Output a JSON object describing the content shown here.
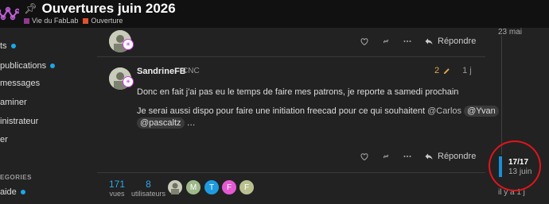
{
  "header": {
    "title": "Ouvertures juin 2026",
    "pin_icon": "pin-icon",
    "categories": [
      {
        "label": "Vie du FabLab",
        "color": "#8e3b8e"
      },
      {
        "label": "Ouverture",
        "color": "#e2522e"
      }
    ]
  },
  "sidebar": {
    "items": [
      {
        "label": "ts",
        "unread": true
      },
      {
        "label": "publications",
        "unread": true
      },
      {
        "label": "messages",
        "unread": false
      },
      {
        "label": "aminer",
        "unread": false
      },
      {
        "label": "inistrateur",
        "unread": false
      },
      {
        "label": "er",
        "unread": false
      }
    ],
    "section": "EGORIES",
    "category_item": {
      "label": "aide",
      "unread": true
    }
  },
  "post_top": {
    "reply_label": "Répondre"
  },
  "post": {
    "username": "SandrineFB",
    "user_title": "CNC",
    "edit_count": "2",
    "time_ago": "1 j",
    "paragraph1": "Donc en fait j'ai pas eu le temps de faire mes patrons, je reporte a samedi prochain",
    "paragraph2_start": "Je serai aussi dispo pour faire une initiation freecad pour ce qui souhaitent",
    "mentions": [
      "@Carlos",
      "@Yvan",
      "@pascaltz"
    ],
    "ellipsis": "…",
    "reply_label": "Répondre"
  },
  "stats": {
    "views": {
      "value": "171",
      "label": "vues"
    },
    "users": {
      "value": "8",
      "label": "utilisateurs"
    }
  },
  "participants": [
    {
      "letter": "M",
      "color": "#9eb98a"
    },
    {
      "letter": "T",
      "color": "#1e9be0"
    },
    {
      "letter": "F",
      "color": "#e35ad1"
    },
    {
      "letter": "F",
      "color": "#b9c08e"
    }
  ],
  "timeline": {
    "top_date": "23 mai",
    "position": "17/17",
    "date": "13 juin",
    "ago": "il y a 1 j"
  },
  "colors": {
    "accent": "#1aa7e8",
    "highlight_ring": "#e0151b"
  }
}
